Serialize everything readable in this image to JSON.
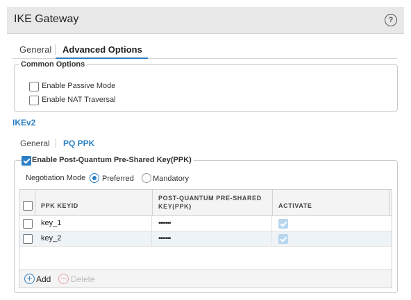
{
  "window": {
    "title": "IKE Gateway"
  },
  "tabs": {
    "general": "General",
    "advanced": "Advanced Options"
  },
  "common_options": {
    "legend": "Common Options",
    "passive_mode": {
      "label": "Enable Passive Mode",
      "checked": false
    },
    "nat_traversal": {
      "label": "Enable NAT Traversal",
      "checked": false
    }
  },
  "ikev2": {
    "section_label": "IKEv2",
    "tabs": {
      "general": "General",
      "pq_ppk": "PQ PPK"
    }
  },
  "ppk": {
    "enable_label": "Enable Post-Quantum Pre-Shared Key(PPK)",
    "enabled": true,
    "negotiation_label": "Negotiation Mode",
    "modes": [
      {
        "label": "Preferred",
        "selected": true
      },
      {
        "label": "Mandatory",
        "selected": false
      }
    ],
    "table": {
      "columns": [
        "PPK KEYID",
        "POST-QUANTUM PRE-SHARED",
        "KEY(PPK)",
        "ACTIVATE"
      ],
      "rows": [
        {
          "keyid": "key_1",
          "key": "•••••••",
          "activate": true
        },
        {
          "keyid": "key_2",
          "key": "•••••••",
          "activate": true
        }
      ]
    },
    "actions": {
      "add": "Add",
      "delete": "Delete"
    }
  },
  "colors": {
    "accent": "#2b7fc4",
    "titlebar": "#e8e8e8",
    "delete_disabled": "#e8a3a3"
  }
}
